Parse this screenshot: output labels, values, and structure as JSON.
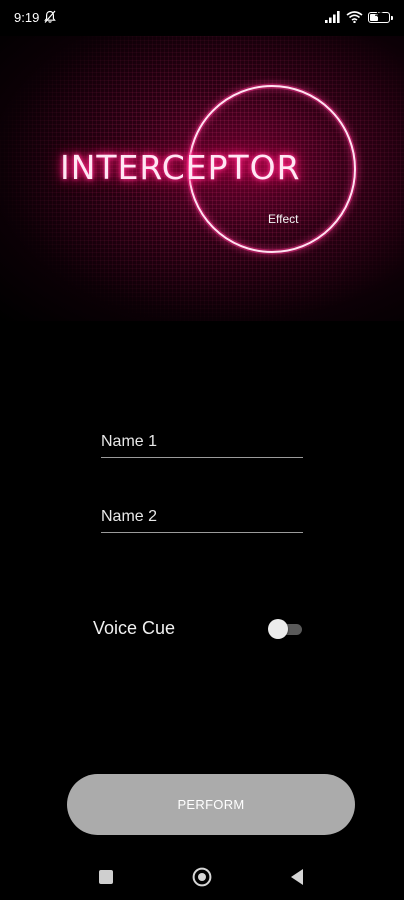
{
  "status_bar": {
    "time": "9:19",
    "bell_icon": "bell-off-icon",
    "signal_icon": "cellular-signal-icon",
    "wifi_icon": "wifi-icon",
    "battery_percent": "45",
    "battery_level": 0.45
  },
  "banner": {
    "title": "INTERCEPTOR",
    "subtitle": "Effect",
    "accent_color": "#ff2f8f"
  },
  "form": {
    "name1_placeholder": "Name 1",
    "name1_value": "",
    "name2_placeholder": "Name 2",
    "name2_value": ""
  },
  "voice_cue": {
    "label": "Voice Cue",
    "enabled": false
  },
  "perform": {
    "label": "PERFORM",
    "color": "#ababab"
  },
  "nav_bar": {
    "recent_icon": "square-recents-icon",
    "home_icon": "circle-home-icon",
    "back_icon": "triangle-back-icon"
  }
}
